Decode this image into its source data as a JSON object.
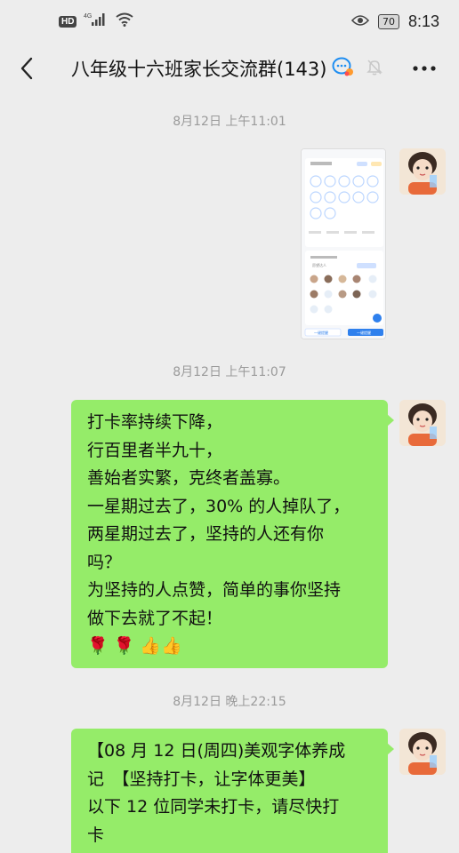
{
  "status_bar": {
    "hd": "HD",
    "network": "4G",
    "battery": "70",
    "time": "8:13"
  },
  "header": {
    "title": "八年级十六班家长交流群(143)",
    "icons": [
      "back-arrow-icon",
      "group-chat-icon",
      "mute-bell-icon",
      "more-icon"
    ]
  },
  "timestamps": [
    "8月12日 上午11:01",
    "8月12日 上午11:07",
    "8月12日 晚上22:15"
  ],
  "image_message": {
    "mini_screen_labels": [
      "愿望达人",
      "一键提醒",
      "一键提醒"
    ]
  },
  "messages": [
    {
      "lines": [
        "打卡率持续下降，",
        "行百里者半九十，",
        "善始者实繁，克终者盖寡。",
        "一星期过去了，30% 的人掉队了，",
        "两星期过去了，坚持的人还有你",
        "吗？",
        "为坚持的人点赞，简单的事你坚持",
        "做下去就了不起！",
        "🌹 🌹 👍👍"
      ]
    },
    {
      "lines": [
        "【08 月 12 日(周四)美观字体养成",
        "记　【坚持打卡，让字体更美】",
        "以下 12 位同学未打卡，请尽快打",
        "卡"
      ]
    }
  ],
  "colors": {
    "background": "#ededed",
    "bubble": "#95ec69",
    "timestamp": "#9a9a9a"
  }
}
